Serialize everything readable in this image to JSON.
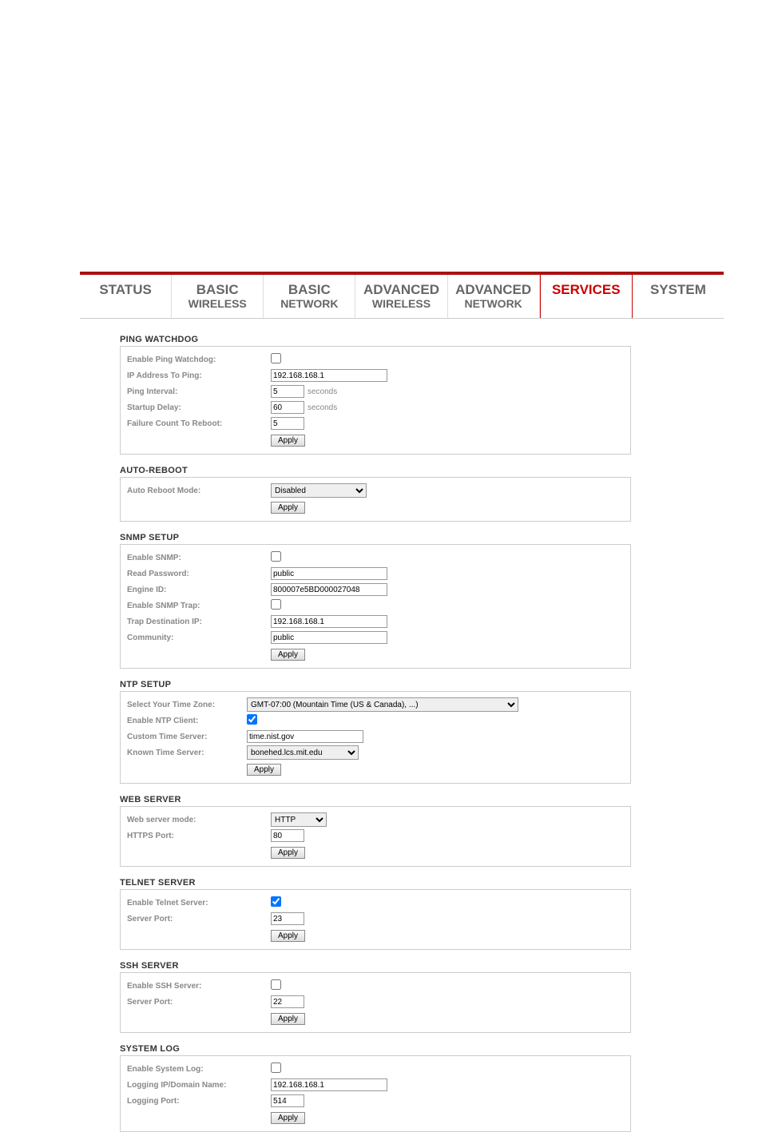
{
  "tabs": {
    "status": "STATUS",
    "basic_wireless_a": "BASIC",
    "basic_wireless_b": "WIRELESS",
    "basic_network_a": "BASIC",
    "basic_network_b": "NETWORK",
    "adv_wireless_a": "ADVANCED",
    "adv_wireless_b": "WIRELESS",
    "adv_network_a": "ADVANCED",
    "adv_network_b": "NETWORK",
    "services": "SERVICES",
    "system": "SYSTEM"
  },
  "btn_apply": "Apply",
  "unit_seconds": "seconds",
  "ping_watchdog": {
    "title": "PING WATCHDOG",
    "enable_label": "Enable Ping Watchdog:",
    "enable": false,
    "ip_label": "IP Address To Ping:",
    "ip": "192.168.168.1",
    "interval_label": "Ping Interval:",
    "interval": "5",
    "startup_label": "Startup Delay:",
    "startup": "60",
    "failure_label": "Failure Count To Reboot:",
    "failure": "5"
  },
  "auto_reboot": {
    "title": "AUTO-REBOOT",
    "mode_label": "Auto Reboot Mode:",
    "mode": "Disabled"
  },
  "snmp": {
    "title": "SNMP SETUP",
    "enable_label": "Enable SNMP:",
    "enable": false,
    "read_label": "Read Password:",
    "read": "public",
    "engine_label": "Engine ID:",
    "engine": "800007e5BD000027048",
    "trap_enable_label": "Enable SNMP Trap:",
    "trap_enable": false,
    "trap_ip_label": "Trap Destination IP:",
    "trap_ip": "192.168.168.1",
    "community_label": "Community:",
    "community": "public"
  },
  "ntp": {
    "title": "NTP SETUP",
    "tz_label": "Select Your Time Zone:",
    "tz": "GMT-07:00 (Mountain Time (US & Canada), ...)",
    "enable_label": "Enable NTP Client:",
    "enable": true,
    "custom_label": "Custom Time Server:",
    "custom": "time.nist.gov",
    "known_label": "Known Time Server:",
    "known": "bonehed.lcs.mit.edu"
  },
  "web": {
    "title": "WEB SERVER",
    "mode_label": "Web server mode:",
    "mode": "HTTP",
    "port_label": "HTTPS Port:",
    "port": "80"
  },
  "telnet": {
    "title": "TELNET SERVER",
    "enable_label": "Enable Telnet Server:",
    "enable": true,
    "port_label": "Server Port:",
    "port": "23"
  },
  "ssh": {
    "title": "SSH SERVER",
    "enable_label": "Enable SSH Server:",
    "enable": false,
    "port_label": "Server Port:",
    "port": "22"
  },
  "syslog": {
    "title": "SYSTEM LOG",
    "enable_label": "Enable System Log:",
    "enable": false,
    "ip_label": "Logging IP/Domain Name:",
    "ip": "192.168.168.1",
    "port_label": "Logging Port:",
    "port": "514"
  }
}
